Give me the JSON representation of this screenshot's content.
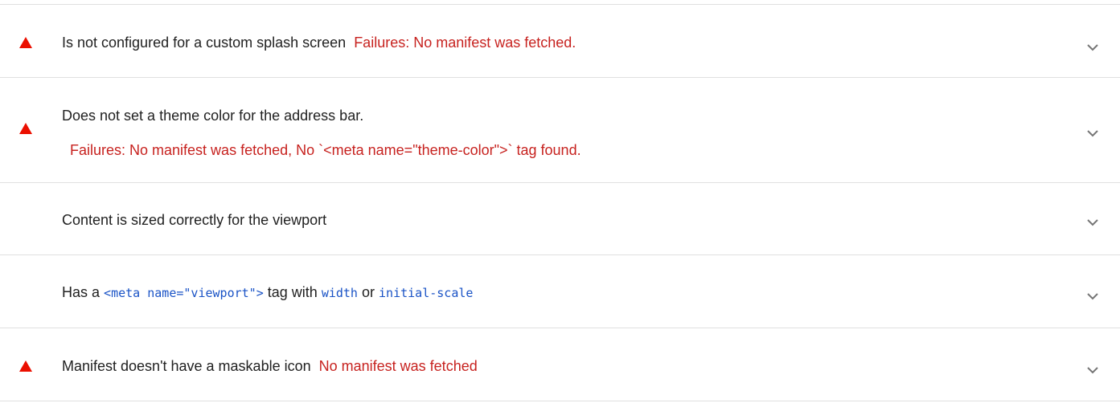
{
  "audits": [
    {
      "title": "Is not configured for a custom splash screen",
      "failure": "Failures: No manifest was fetched.",
      "status": "fail"
    },
    {
      "title": "Does not set a theme color for the address bar.",
      "failure": "Failures: No manifest was fetched, No `<meta name=\"theme-color\">` tag found.",
      "status": "fail"
    },
    {
      "title": "Content is sized correctly for the viewport",
      "status": "pass"
    },
    {
      "title_prefix": "Has a",
      "code1": "<meta name=\"viewport\">",
      "title_mid": "tag with",
      "code2": "width",
      "title_or": "or",
      "code3": "initial-scale",
      "status": "pass"
    },
    {
      "title": "Manifest doesn't have a maskable icon",
      "failure": "No manifest was fetched",
      "status": "fail"
    }
  ],
  "icons": {
    "fail": "fail-triangle-icon",
    "expand": "chevron-down-icon"
  },
  "colors": {
    "fail": "#eb0f00",
    "failure_text": "#c7221f",
    "code": "#1a53c6",
    "divider": "#e0e0e0"
  }
}
